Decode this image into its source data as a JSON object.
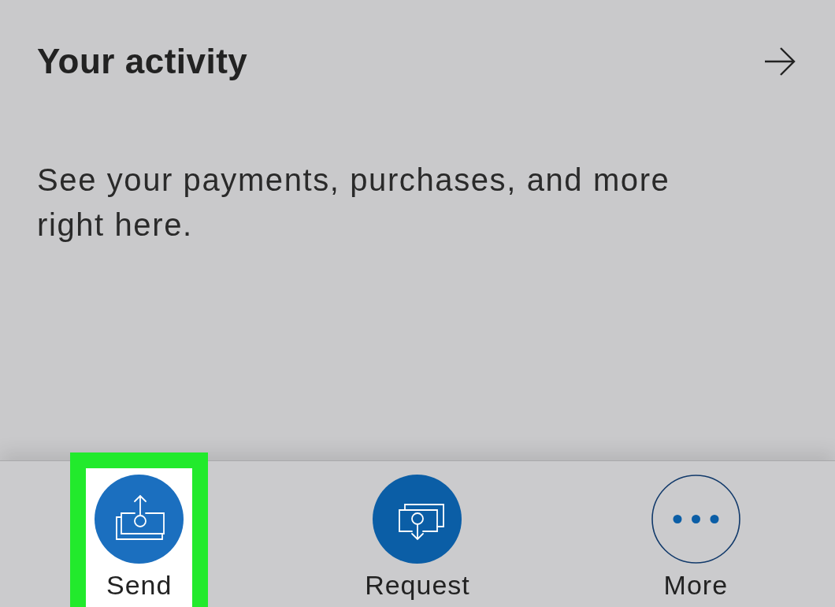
{
  "activity_card": {
    "title": "Your activity",
    "description": "See your payments, purchases, and more right here."
  },
  "bottom_nav": [
    {
      "kind": "send",
      "label": "Send",
      "highlighted": true
    },
    {
      "kind": "request",
      "label": "Request",
      "highlighted": false
    },
    {
      "kind": "more",
      "label": "More",
      "highlighted": false
    }
  ]
}
